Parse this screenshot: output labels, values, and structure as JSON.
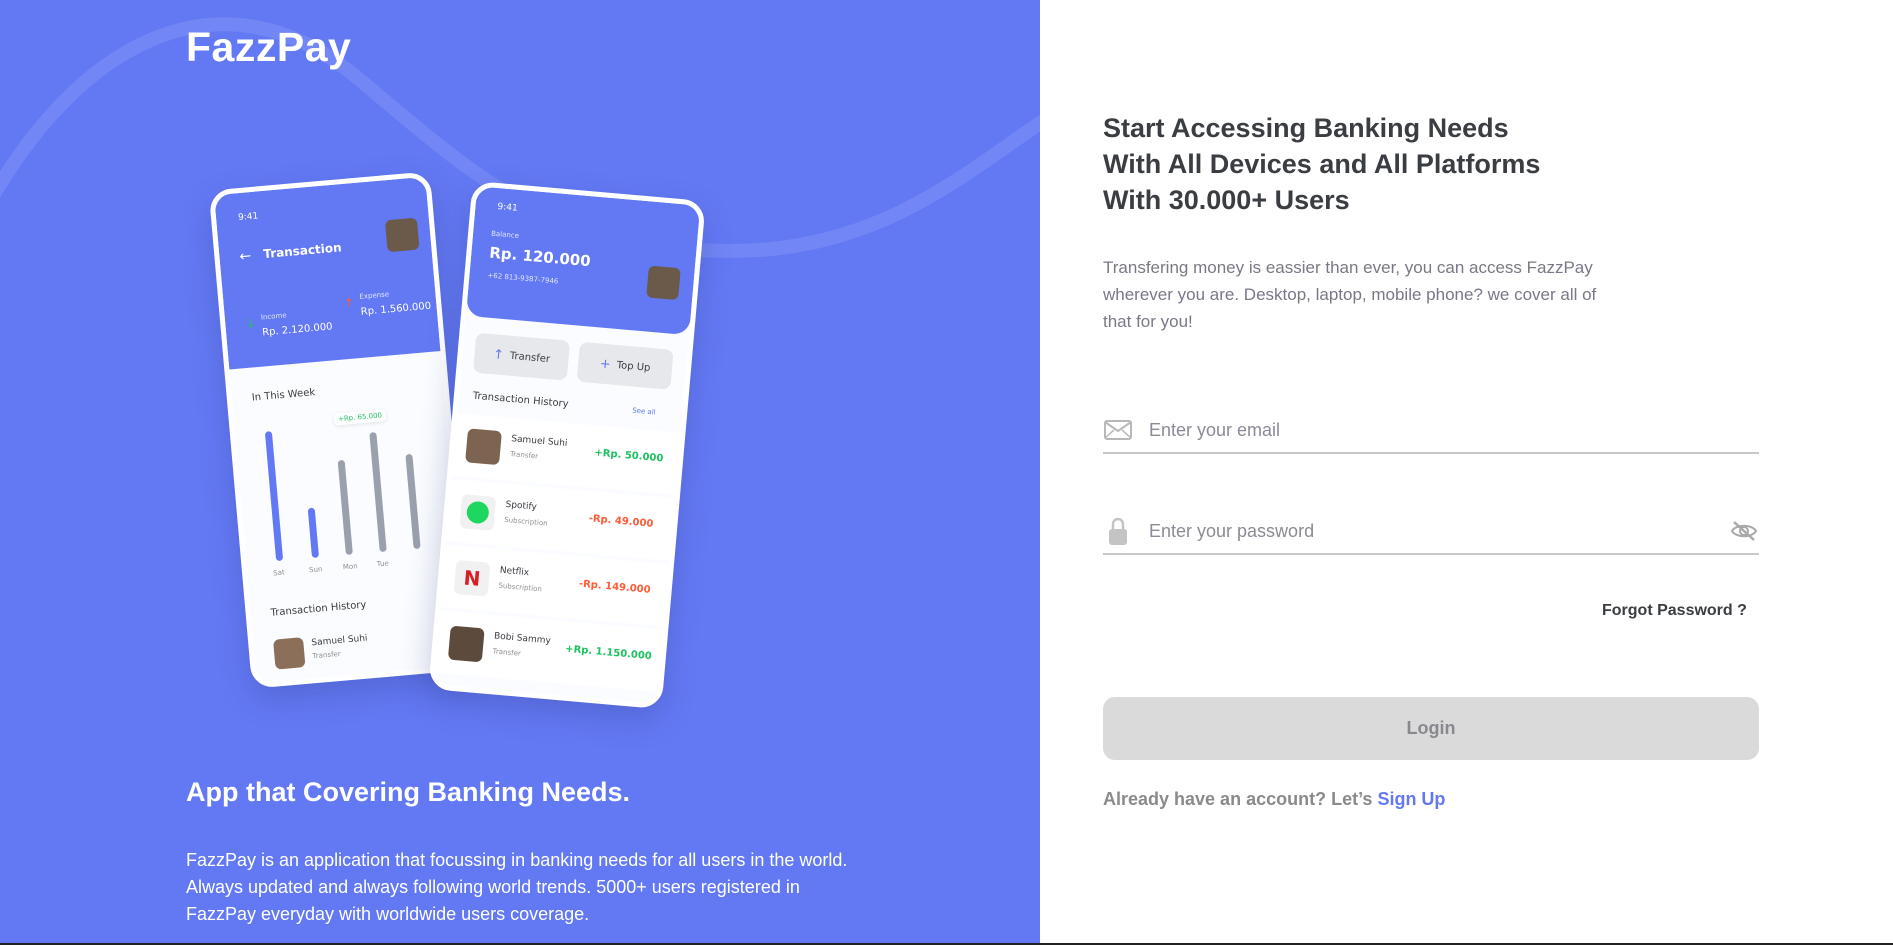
{
  "brand": "FazzPay",
  "left": {
    "title": "App that Covering Banking Needs.",
    "description": "FazzPay is an application that focussing in banking needs for all users in the world. Always updated and always following world trends. 5000+ users registered in FazzPay everyday with worldwide users coverage."
  },
  "phone_back": {
    "time": "9:41",
    "title": "Transaction",
    "income_label": "Income",
    "income_value": "Rp. 2.120.000",
    "expense_label": "Expense",
    "expense_value": "Rp. 1.560.000",
    "week_title": "In This Week",
    "tooltip": "+Rp. 65.000",
    "days": [
      "Sat",
      "Sun",
      "Mon",
      "Tue"
    ],
    "history_title": "Transaction History",
    "history_name": "Samuel Suhi",
    "history_type": "Transfer"
  },
  "phone_front": {
    "time": "9:41",
    "balance_label": "Balance",
    "balance_value": "Rp. 120.000",
    "phone_number": "+62 813-9387-7946",
    "transfer_label": "Transfer",
    "topup_label": "Top Up",
    "history_title": "Transaction History",
    "see_all": "See all",
    "transactions": [
      {
        "name": "Samuel Suhi",
        "type": "Transfer",
        "amount": "+Rp. 50.000",
        "color": "#1ec15f"
      },
      {
        "name": "Spotify",
        "type": "Subscription",
        "amount": "-Rp. 49.000",
        "color": "#ff5b37"
      },
      {
        "name": "Netflix",
        "type": "Subscription",
        "amount": "-Rp. 149.000",
        "color": "#ff5b37"
      },
      {
        "name": "Bobi Sammy",
        "type": "Transfer",
        "amount": "+Rp. 1.150.000",
        "color": "#1ec15f"
      }
    ]
  },
  "right": {
    "headline": [
      "Start Accessing Banking Needs",
      "With All Devices and All Platforms",
      "With 30.000+ Users"
    ],
    "subtext": "Transfering money is eassier than ever, you can access FazzPay wherever you are. Desktop, laptop, mobile phone? we cover all of that for you!",
    "email_placeholder": "Enter your email",
    "password_placeholder": "Enter your password",
    "forgot_password": "Forgot Password ?",
    "login_button": "Login",
    "signup_prompt": "Already have an account? Let’s",
    "signup_link": "Sign Up"
  },
  "colors": {
    "primary": "#6379f4",
    "income": "#1ec15f",
    "expense": "#ff5b37",
    "button_disabled": "#dadada"
  },
  "icons": [
    "mail-icon",
    "lock-icon",
    "eye-off-icon",
    "arrow-up-icon",
    "plus-icon",
    "back-arrow-icon"
  ]
}
